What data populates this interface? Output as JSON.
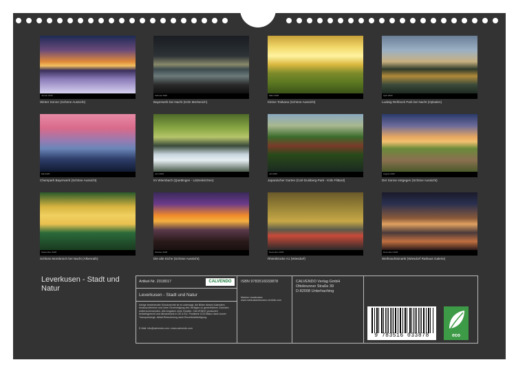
{
  "months": [
    {
      "month": "Januar 2026",
      "caption": "Winter Sonne (Schöne Aussicht)"
    },
    {
      "month": "Februar 2026",
      "caption": "Bayerwerk bei Nacht (Köln Merkenich)"
    },
    {
      "month": "März 2026",
      "caption": "Kleine Toskana (Schöne Aussicht)"
    },
    {
      "month": "April 2026",
      "caption": "Ludwig Rehbock Park bei Nacht (Opladen)"
    },
    {
      "month": "Mai 2026",
      "caption": "Chempark Bayerwerk (Schöne Aussicht)"
    },
    {
      "month": "Juni 2026",
      "caption": "Im Wiembach (Quettingen - Lützenkirchen)"
    },
    {
      "month": "Juli 2026",
      "caption": "Japanischer Garten (Carl-Duisberg-Park - Köln Flittard)"
    },
    {
      "month": "August 2026",
      "caption": "Der Sonne entgegen (Schöne Aussicht)"
    },
    {
      "month": "September 2026",
      "caption": "Schloss Morsbroich bei Nacht (Alkenrath)"
    },
    {
      "month": "Oktober 2026",
      "caption": "Die alte Eiche (Schöne Aussicht)"
    },
    {
      "month": "November 2026",
      "caption": "Rheinbrücke A1 (Wiesdorf)"
    },
    {
      "month": "Dezember 2026",
      "caption": "Weihnachtsmarkt (Wiesdorf Rathaus Galerie)"
    }
  ],
  "title": "Leverkusen - Stadt und Natur",
  "info": {
    "article": "Artikel-Nr. 2018017",
    "logo": "CALVENDO",
    "product_title": "Leverkusen - Stadt und Natur",
    "legal": "Infolge bestehender Schutzrechte ist es untersagt, die Bilder dieses Kalenders herauszutrennen und ohne Genehmigung des Verlages zu gewerblichen Zwecken weiterzuverwenden. Alle Angaben ohne Gewähr. CALVENDO produziert bedarfsgerecht und klimaneutral in DE & EU. Postkarte CO2-Bilanz dank kurzer Transportwege. Abfall-Reduzierung dank Einzelstückfertigung.",
    "email": "E-Mail: info@calvendo.com • www.calvendo.com",
    "isbn": "ISBN 9783516033878",
    "author": "Markus Landsmann",
    "author_web": "www.markuslandsmann.zenfolio.com",
    "publisher": "CALVENDO Verlag GmbH",
    "street": "Ottobrunner Straße 39",
    "city": "D-82008 Unterhaching",
    "barcode_digits": "9 783516 033878",
    "eco_label": "eco"
  }
}
